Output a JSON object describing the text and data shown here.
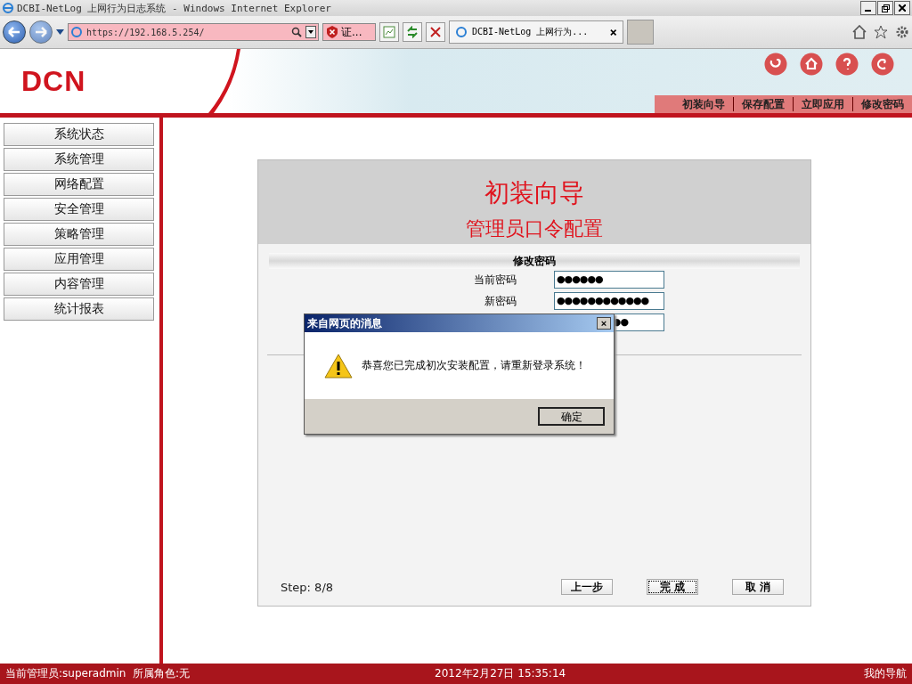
{
  "window": {
    "title": "DCBI-NetLog 上网行为日志系统 - Windows Internet Explorer"
  },
  "browser": {
    "address": "https://192.168.5.254/",
    "cert_error": "证...",
    "tabs": [
      {
        "label": "DCBI-NetLog 上网行为...",
        "close": "×",
        "selected": true
      }
    ]
  },
  "header": {
    "logo": "DCN",
    "menu": [
      {
        "label": "初装向导"
      },
      {
        "label": "保存配置"
      },
      {
        "label": "立即应用"
      },
      {
        "label": "修改密码"
      }
    ]
  },
  "sidebar": {
    "items": [
      {
        "label": "系统状态"
      },
      {
        "label": "系统管理"
      },
      {
        "label": "网络配置"
      },
      {
        "label": "安全管理"
      },
      {
        "label": "策略管理"
      },
      {
        "label": "应用管理"
      },
      {
        "label": "内容管理"
      },
      {
        "label": "统计报表"
      }
    ]
  },
  "wizard": {
    "title": "初装向导",
    "subtitle": "管理员口令配置",
    "section": "修改密码",
    "fields": [
      {
        "label": "当前密码",
        "value": "●●●●●●"
      },
      {
        "label": "新密码",
        "value": "●●●●●●●●●●●●"
      },
      {
        "value": "●●",
        "covered": true
      }
    ],
    "step": "Step: 8/8",
    "buttons": [
      {
        "label": "上一步",
        "focused": false
      },
      {
        "label": "完 成",
        "focused": true
      },
      {
        "label": "取 消",
        "focused": false
      }
    ]
  },
  "dialog": {
    "title": "来自网页的消息",
    "close": "×",
    "message": "恭喜您已完成初次安装配置，请重新登录系统！",
    "button": "确定"
  },
  "status_bar": {
    "user": "当前管理员:superadmin  所属角色:无",
    "datetime": "2012年2月27日 15:35:14",
    "nav": "我的导航"
  }
}
